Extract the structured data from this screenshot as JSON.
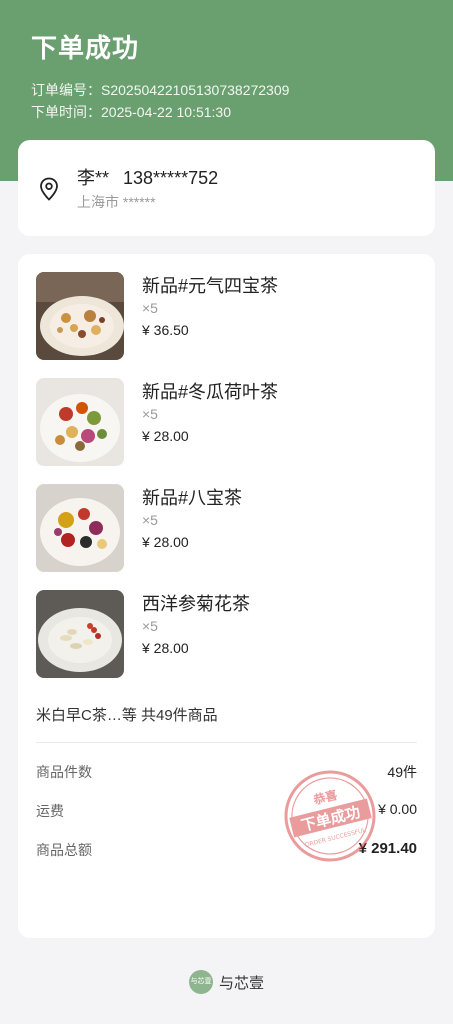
{
  "header": {
    "title": "下单成功",
    "order_no_label": "订单编号：",
    "order_no": "S20250422105130738272309",
    "order_time_label": "下单时间：",
    "order_time": "2025-04-22 10:51:30",
    "bg_color": "#6a9f6f"
  },
  "address": {
    "name": "李**",
    "phone": "138*****752",
    "city": "上海市 ******",
    "icon": "location-pin-icon"
  },
  "items": [
    {
      "name": "新品#元气四宝茶",
      "qty": "×5",
      "price": "¥ 36.50"
    },
    {
      "name": "新品#冬瓜荷叶茶",
      "qty": "×5",
      "price": "¥ 28.00"
    },
    {
      "name": "新品#八宝茶",
      "qty": "×5",
      "price": "¥ 28.00"
    },
    {
      "name": "西洋参菊花茶",
      "qty": "×5",
      "price": "¥ 28.00"
    }
  ],
  "summary": {
    "more_text": "米白早C茶…等 共49件商品",
    "count_label": "商品件数",
    "count_value": "49件",
    "shipping_label": "运费",
    "shipping_value": "¥ 0.00",
    "total_label": "商品总额",
    "total_value": "¥ 291.40"
  },
  "stamp": {
    "top_text": "恭喜",
    "main_text": "下单成功",
    "sub_text": "ORDER SUCCESSFUL",
    "color": "#d94a4a"
  },
  "footer": {
    "logo_text": "与芯壹",
    "brand": "与芯壹"
  }
}
